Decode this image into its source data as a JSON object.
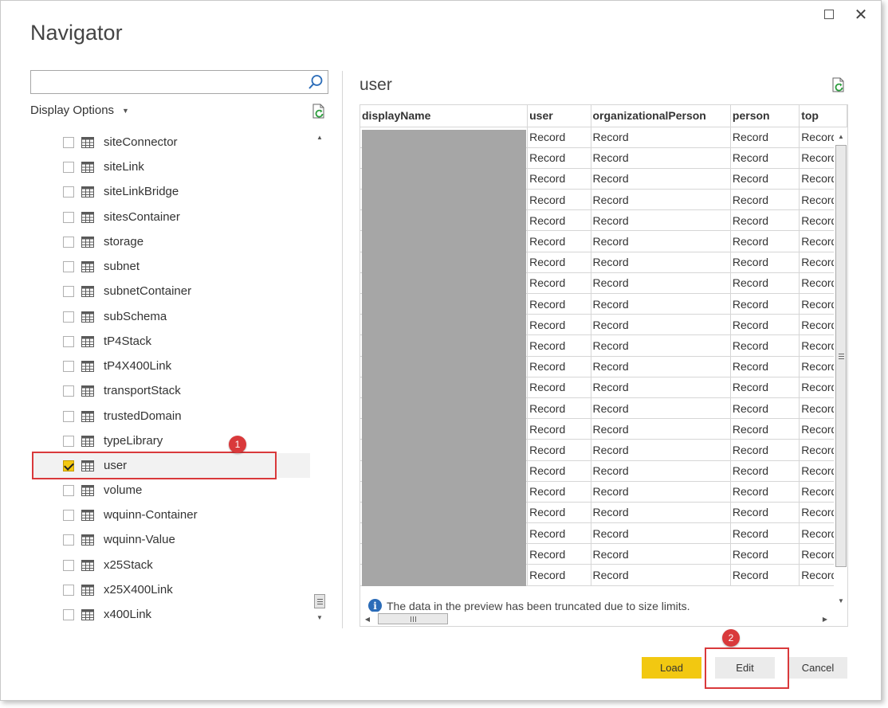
{
  "window": {
    "title": "Navigator",
    "maximize_icon": "maximize-icon",
    "close_icon": "close-icon",
    "close_glyph": "✕"
  },
  "left_pane": {
    "search": {
      "value": "",
      "placeholder": ""
    },
    "display_options_label": "Display Options",
    "items": [
      {
        "label": "siteConnector",
        "checked": false
      },
      {
        "label": "siteLink",
        "checked": false
      },
      {
        "label": "siteLinkBridge",
        "checked": false
      },
      {
        "label": "sitesContainer",
        "checked": false
      },
      {
        "label": "storage",
        "checked": false
      },
      {
        "label": "subnet",
        "checked": false
      },
      {
        "label": "subnetContainer",
        "checked": false
      },
      {
        "label": "subSchema",
        "checked": false
      },
      {
        "label": "tP4Stack",
        "checked": false
      },
      {
        "label": "tP4X400Link",
        "checked": false
      },
      {
        "label": "transportStack",
        "checked": false
      },
      {
        "label": "trustedDomain",
        "checked": false
      },
      {
        "label": "typeLibrary",
        "checked": false
      },
      {
        "label": "user",
        "checked": true
      },
      {
        "label": "volume",
        "checked": false
      },
      {
        "label": "wquinn-Container",
        "checked": false
      },
      {
        "label": "wquinn-Value",
        "checked": false
      },
      {
        "label": "x25Stack",
        "checked": false
      },
      {
        "label": "x25X400Link",
        "checked": false
      },
      {
        "label": "x400Link",
        "checked": false
      }
    ]
  },
  "annotations": {
    "badge1": "1",
    "badge2": "2",
    "color": "#d9393b"
  },
  "preview": {
    "title": "user",
    "columns": [
      "displayName",
      "user",
      "organizationalPerson",
      "person",
      "top"
    ],
    "cell_value": "Record",
    "row_count": 22,
    "truncation_note": "The data in the preview has been truncated due to size limits."
  },
  "footer": {
    "load_label": "Load",
    "edit_label": "Edit",
    "cancel_label": "Cancel"
  },
  "colors": {
    "accent_yellow": "#f2c811",
    "button_gray": "#ebebeb",
    "info_blue": "#2b6cb8"
  }
}
